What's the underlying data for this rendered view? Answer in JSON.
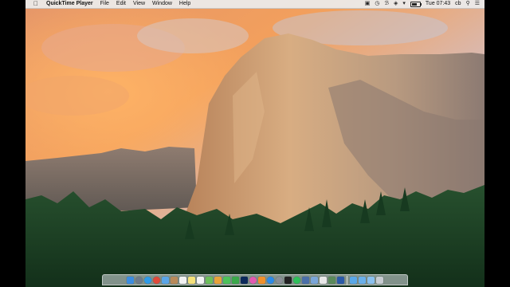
{
  "menubar": {
    "apple_icon": "apple-icon",
    "app_name": "QuickTime Player",
    "menus": [
      "File",
      "Edit",
      "View",
      "Window",
      "Help"
    ],
    "status_icons": [
      "camera-icon",
      "clock-icon",
      "bluetooth-icon",
      "wifi-icon",
      "volume-icon"
    ],
    "time": "Tue 07:43",
    "user": "cb",
    "right_icons": [
      "search-icon",
      "list-icon"
    ]
  },
  "desktop": {
    "wallpaper": "Yosemite El Capitan",
    "sky_colors": [
      "#f39a5a",
      "#9fb4d8"
    ],
    "rock_color": "#c89a6c",
    "forest_color": "#1f4326"
  },
  "dock": {
    "apps": [
      {
        "icon": "finder-icon",
        "color": "#3b8de0"
      },
      {
        "icon": "launchpad-icon",
        "color": "#6f7b8a"
      },
      {
        "icon": "safari-icon",
        "color": "#2d9be8"
      },
      {
        "icon": "chrome-icon",
        "color": "#e04a3a"
      },
      {
        "icon": "mail-icon",
        "color": "#5aa6e8"
      },
      {
        "icon": "contacts-icon",
        "color": "#b88a5a"
      },
      {
        "icon": "calendar-icon",
        "color": "#f2f2f2"
      },
      {
        "icon": "notes-icon",
        "color": "#f5e27a"
      },
      {
        "icon": "reminders-icon",
        "color": "#f4f4f4"
      },
      {
        "icon": "maps-icon",
        "color": "#6cbf5a"
      },
      {
        "icon": "photos-icon",
        "color": "#e8a23a"
      },
      {
        "icon": "messages-icon",
        "color": "#4cc25a"
      },
      {
        "icon": "facetime-icon",
        "color": "#3aa84a"
      },
      {
        "icon": "photoshop-icon",
        "color": "#0c2a5a"
      },
      {
        "icon": "itunes-icon",
        "color": "#e25ab0"
      },
      {
        "icon": "ibooks-icon",
        "color": "#f0902a"
      },
      {
        "icon": "appstore-icon",
        "color": "#2b8be8"
      },
      {
        "icon": "system-preferences-icon",
        "color": "#8a8f96"
      },
      {
        "icon": "terminal-icon",
        "color": "#222222"
      },
      {
        "icon": "spotify-icon",
        "color": "#2fbf5a"
      },
      {
        "icon": "quicktime-icon",
        "color": "#4a6fa8"
      },
      {
        "icon": "preview-icon",
        "color": "#7aa6d8"
      },
      {
        "icon": "textedit-icon",
        "color": "#e8e8e8"
      },
      {
        "icon": "activity-monitor-icon",
        "color": "#5a8a5a"
      },
      {
        "icon": "word-icon",
        "color": "#2b5aa8"
      }
    ],
    "folders": [
      {
        "icon": "applications-folder-icon",
        "color": "#5aa8e8"
      },
      {
        "icon": "documents-folder-icon",
        "color": "#6ab0ea"
      },
      {
        "icon": "downloads-folder-icon",
        "color": "#8ac0ee"
      },
      {
        "icon": "trash-icon",
        "color": "#c8ccd2"
      }
    ]
  }
}
